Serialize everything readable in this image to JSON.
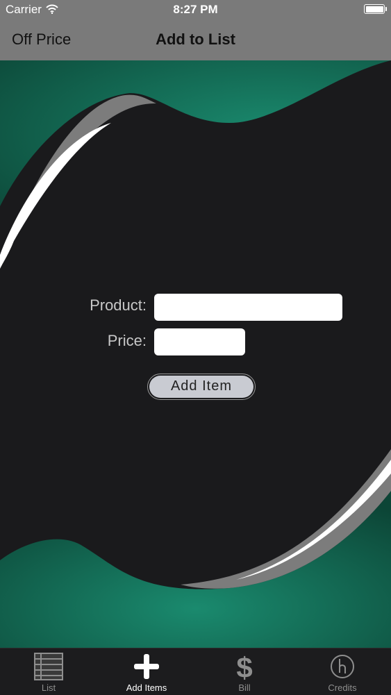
{
  "status_bar": {
    "carrier": "Carrier",
    "time": "8:27 PM",
    "battery_level": 1.0
  },
  "nav": {
    "back_label": "Off Price",
    "title": "Add to List"
  },
  "form": {
    "product_label": "Product:",
    "product_value": "",
    "price_label": "Price:",
    "price_value": "",
    "add_button_label": "Add Item"
  },
  "tabs": [
    {
      "label": "List",
      "icon": "list-icon",
      "active": false
    },
    {
      "label": "Add Items",
      "icon": "plus-icon",
      "active": true
    },
    {
      "label": "Bill",
      "icon": "dollar-icon",
      "active": false
    },
    {
      "label": "Credits",
      "icon": "credits-icon",
      "active": false
    }
  ],
  "colors": {
    "bar_gray": "#7a7a7a",
    "background": "#1a1a1c",
    "accent_green": "#14785f",
    "tab_bar": "#1c1c1e"
  }
}
